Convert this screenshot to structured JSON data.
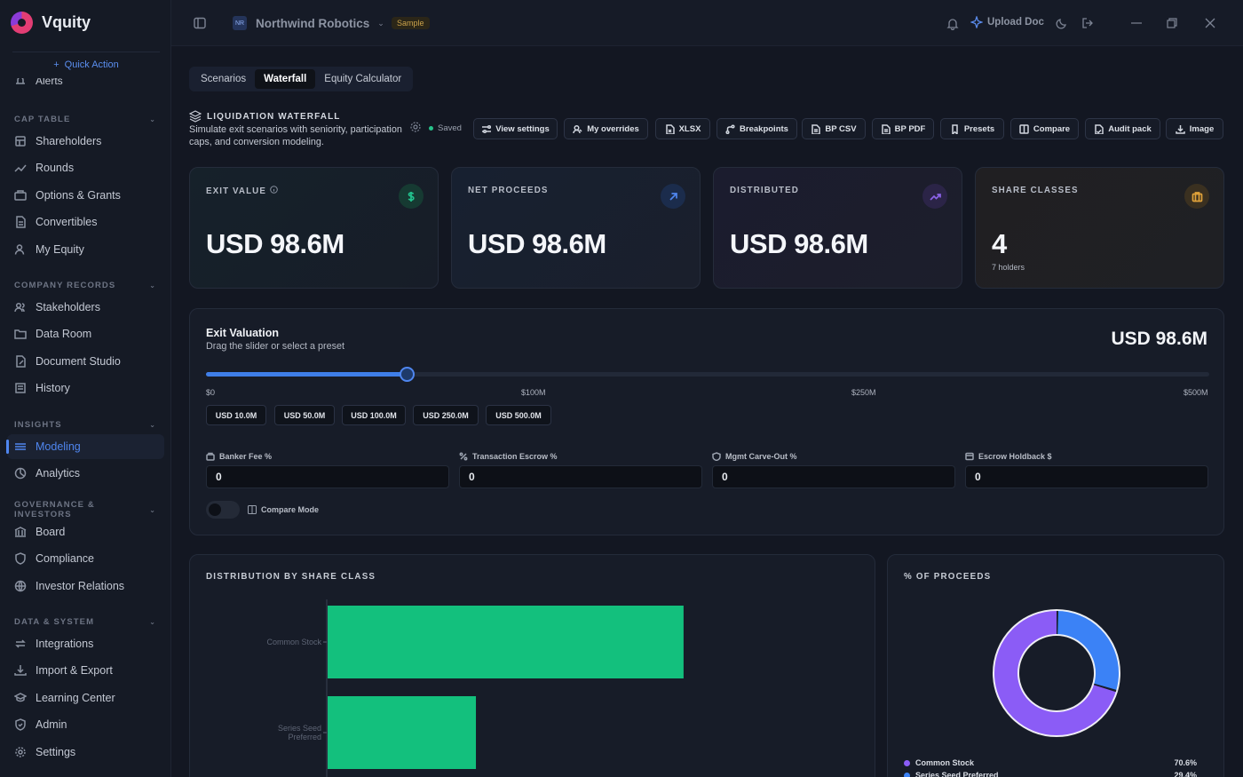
{
  "app": {
    "name": "Vquity"
  },
  "sidebar": {
    "quick_action": "Quick Action",
    "partial_item": "Alerts",
    "sections": [
      {
        "title": "CAP TABLE",
        "items": [
          "Shareholders",
          "Rounds",
          "Options & Grants",
          "Convertibles",
          "My Equity"
        ]
      },
      {
        "title": "COMPANY RECORDS",
        "items": [
          "Stakeholders",
          "Data Room",
          "Document Studio",
          "History"
        ]
      },
      {
        "title": "INSIGHTS",
        "items": [
          "Modeling",
          "Analytics"
        ]
      },
      {
        "title": "GOVERNANCE & INVESTORS",
        "items": [
          "Board",
          "Compliance",
          "Investor Relations"
        ]
      },
      {
        "title": "DATA & SYSTEM",
        "items": [
          "Integrations",
          "Import & Export",
          "Learning Center",
          "Admin",
          "Settings"
        ]
      }
    ],
    "active_item": "Modeling"
  },
  "topbar": {
    "workspace_initials": "NR",
    "workspace": "Northwind Robotics",
    "sample_badge": "Sample",
    "upload_label": "Upload Doc"
  },
  "tabs": [
    {
      "label": "Scenarios",
      "active": false
    },
    {
      "label": "Waterfall",
      "active": true
    },
    {
      "label": "Equity Calculator",
      "active": false
    }
  ],
  "waterfall": {
    "title": "LIQUIDATION WATERFALL",
    "description": "Simulate exit scenarios with seniority, participation caps, and conversion modeling.",
    "saved_label": "Saved",
    "actions": [
      "View settings",
      "My overrides",
      "XLSX",
      "Breakpoints",
      "BP CSV",
      "BP PDF",
      "Presets",
      "Compare",
      "Audit pack",
      "Image"
    ]
  },
  "kpis": [
    {
      "label": "EXIT VALUE",
      "value": "USD 98.6M",
      "sub": "",
      "icon": "dollar-icon",
      "color": "#22c38e"
    },
    {
      "label": "NET PROCEEDS",
      "value": "USD 98.6M",
      "sub": "",
      "icon": "arrow-up-right-icon",
      "color": "#4f86ef"
    },
    {
      "label": "DISTRIBUTED",
      "value": "USD 98.6M",
      "sub": "",
      "icon": "trending-up-icon",
      "color": "#8b63e8"
    },
    {
      "label": "SHARE CLASSES",
      "value": "4",
      "sub": "7 holders",
      "icon": "briefcase-icon",
      "color": "#e0a23a"
    }
  ],
  "exit_valuation": {
    "title": "Exit Valuation",
    "subtitle": "Drag the slider or select a preset",
    "display_value": "USD 98.6M",
    "slider_fraction": 0.2,
    "ticks": [
      "$0",
      "$100M",
      "$250M",
      "$500M"
    ],
    "presets": [
      "USD 10.0M",
      "USD 50.0M",
      "USD 100.0M",
      "USD 250.0M",
      "USD 500.0M"
    ],
    "fields": [
      {
        "label": "Banker Fee %",
        "value": "0"
      },
      {
        "label": "Transaction Escrow %",
        "value": "0"
      },
      {
        "label": "Mgmt Carve-Out %",
        "value": "0"
      },
      {
        "label": "Escrow Holdback $",
        "value": "0"
      }
    ],
    "compare_mode_label": "Compare Mode",
    "compare_mode_on": false
  },
  "chart_data": [
    {
      "type": "bar",
      "orientation": "horizontal",
      "title": "DISTRIBUTION BY SHARE CLASS",
      "categories": [
        "Common Stock",
        "Series Seed\nPreferred"
      ],
      "values": [
        69.6,
        29.0
      ],
      "color": "#13c07d"
    },
    {
      "type": "pie",
      "donut": true,
      "title": "% OF PROCEEDS",
      "labels": [
        "Common Stock",
        "Series Seed Preferred"
      ],
      "values": [
        70.6,
        29.4
      ],
      "value_labels": [
        "70.6%",
        "29.4%"
      ],
      "colors": [
        "#8b5cf6",
        "#3b82f6"
      ]
    }
  ]
}
